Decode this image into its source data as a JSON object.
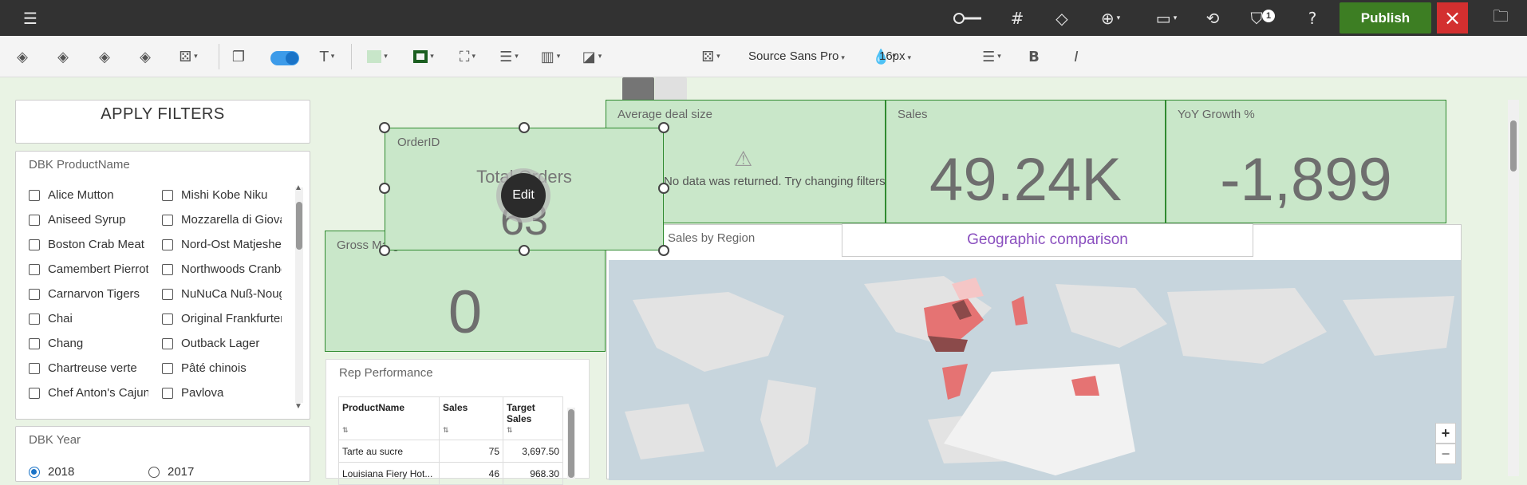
{
  "topbar": {
    "publish_label": "Publish",
    "filter_badge": "1",
    "close_icon": "×"
  },
  "toolbar": {
    "font_family": "Source Sans Pro",
    "font_size": "16px",
    "colors": {
      "fill": "#c8e6c9",
      "border": "#1b5e20"
    }
  },
  "apply_filters": {
    "label": "APPLY FILTERS"
  },
  "product_filter": {
    "title": "DBK ProductName",
    "col1": [
      "Alice Mutton",
      "Aniseed Syrup",
      "Boston Crab Meat",
      "Camembert Pierrot",
      "Carnarvon Tigers",
      "Chai",
      "Chang",
      "Chartreuse verte",
      "Chef Anton's Cajun ..."
    ],
    "col2": [
      "Mishi Kobe Niku",
      "Mozzarella di Giovan",
      "Nord-Ost Matjesheri...",
      "Northwoods Cranbe...",
      "NuNuCa Nuß-Noug...",
      "Original Frankfurter ...",
      "Outback Lager",
      "Pâté chinois",
      "Pavlova"
    ]
  },
  "year_filter": {
    "title": "DBK Year",
    "options": [
      "2018",
      "2017"
    ],
    "selected": "2018"
  },
  "kpis": {
    "orderid": {
      "title": "OrderID",
      "label": "Total Orders",
      "value": "63"
    },
    "avg_deal": {
      "title": "Average deal size",
      "message": "No data was returned. Try changing filters."
    },
    "sales": {
      "title": "Sales",
      "value": "49.24K"
    },
    "yoy": {
      "title": "YoY Growth %",
      "value": "-1,899"
    },
    "gross": {
      "title": "Gross Margin",
      "value": "0"
    }
  },
  "edit_label": "Edit",
  "map": {
    "title": "Sales by Region",
    "overlay_title": "Geographic comparison",
    "zoom_in": "+",
    "zoom_out": "−",
    "colors": {
      "high": "#8b4a4a",
      "mid": "#e57373",
      "low": "#f5c6c6",
      "water": "#c7d5dd",
      "land": "#e3e3e3"
    }
  },
  "rep": {
    "title": "Rep Performance",
    "headers": [
      "ProductName",
      "Sales",
      "Target Sales"
    ],
    "rows": [
      [
        "Tarte au sucre",
        "75",
        "3,697.50"
      ],
      [
        "Louisiana Fiery Hot...",
        "46",
        "968.30"
      ]
    ]
  }
}
